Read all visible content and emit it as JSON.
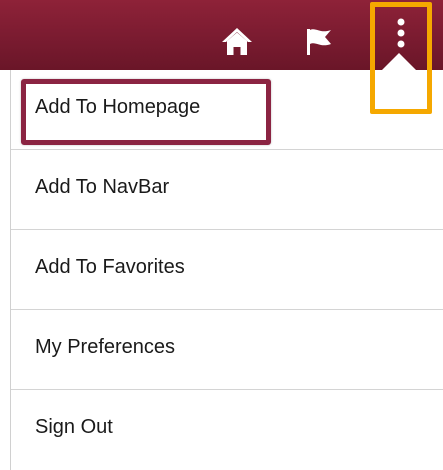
{
  "header": {
    "background_color": "#7a1b30",
    "icons": {
      "home": "home-icon",
      "flag": "flag-icon",
      "more": "more-vertical-icon"
    }
  },
  "callout": {
    "actions_highlight_color": "#f5a800",
    "item_highlight_color": "#8b2442"
  },
  "menu": {
    "items": [
      {
        "label": "Add To Homepage"
      },
      {
        "label": "Add To NavBar"
      },
      {
        "label": "Add To Favorites"
      },
      {
        "label": "My Preferences"
      },
      {
        "label": "Sign Out"
      }
    ]
  }
}
